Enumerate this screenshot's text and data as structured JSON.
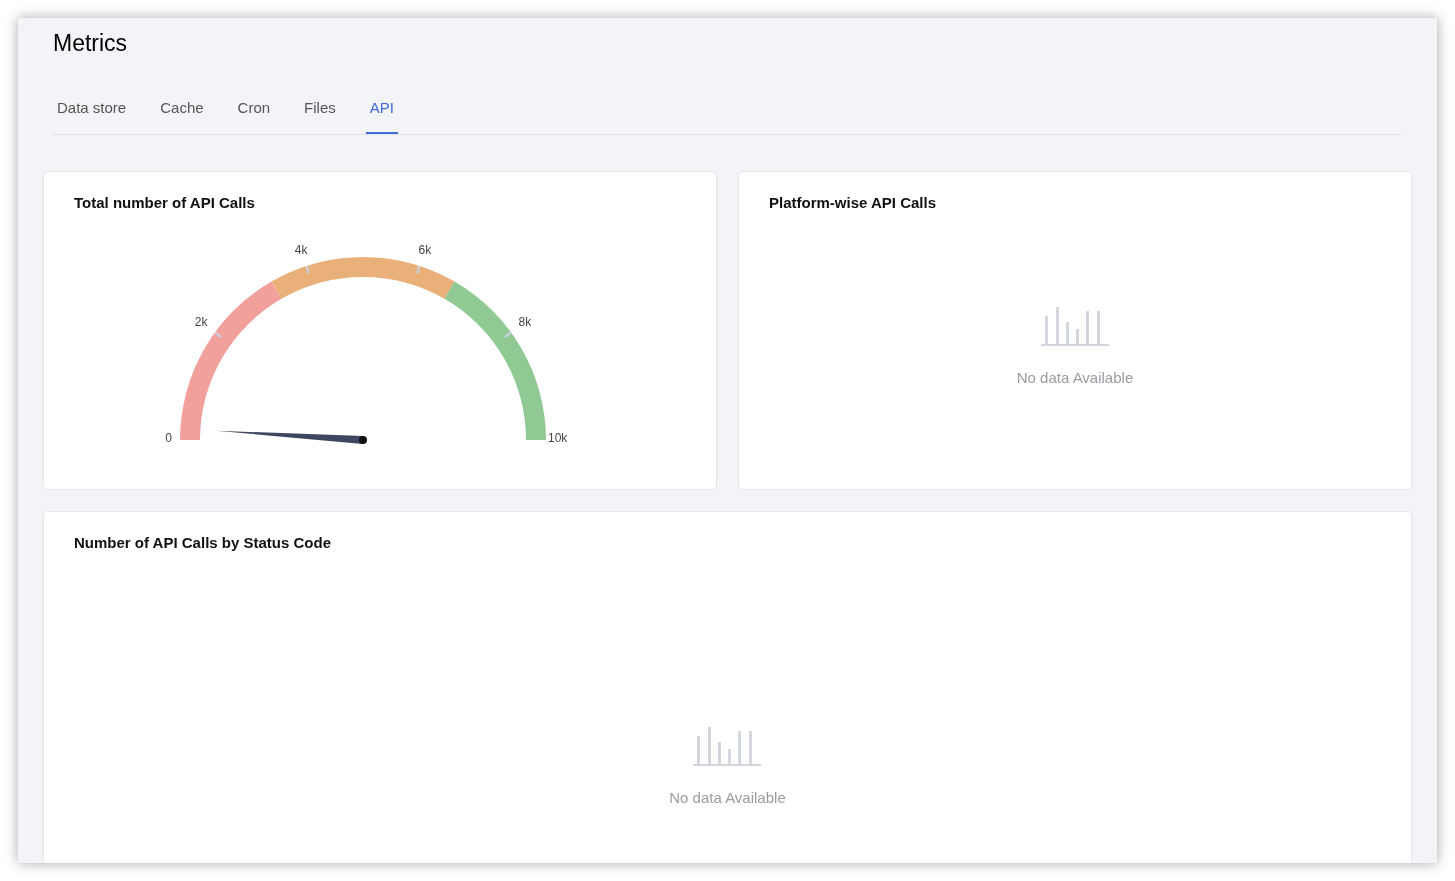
{
  "page": {
    "title": "Metrics"
  },
  "tabs": [
    {
      "label": "Data store",
      "selected": false
    },
    {
      "label": "Cache",
      "selected": false
    },
    {
      "label": "Cron",
      "selected": false
    },
    {
      "label": "Files",
      "selected": false
    },
    {
      "label": "API",
      "selected": true
    }
  ],
  "gauge_card": {
    "title": "Total number of API Calls",
    "gauge": {
      "level": 0.02,
      "ticks": [
        "0",
        "2k",
        "4k",
        "6k",
        "8k",
        "10k"
      ],
      "bands": [
        {
          "color": "#f2a09c"
        },
        {
          "color": "#e9b07a"
        },
        {
          "color": "#90c994"
        }
      ]
    }
  },
  "platform_card": {
    "title": "Platform-wise API Calls",
    "empty_message": "No data Available"
  },
  "status_card": {
    "title": "Number of API Calls by Status Code",
    "empty_message": "No data Available"
  }
}
